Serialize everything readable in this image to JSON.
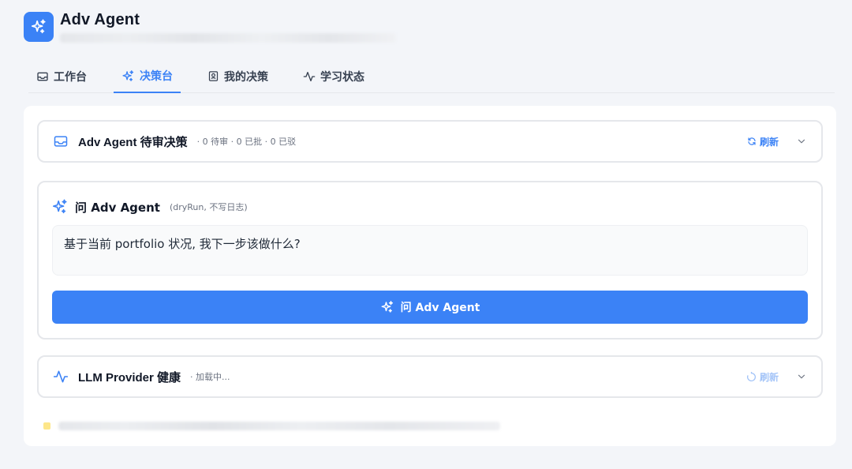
{
  "app": {
    "title": "Adv Agent"
  },
  "tabs": [
    {
      "label": "工作台",
      "icon": "inbox-icon"
    },
    {
      "label": "决策台",
      "icon": "sparkles-icon"
    },
    {
      "label": "我的决策",
      "icon": "user-square-icon"
    },
    {
      "label": "学习状态",
      "icon": "activity-icon"
    }
  ],
  "queue": {
    "title": "Adv Agent 待审决策",
    "meta": "· 0 待审 · 0 已批 · 0 已驳",
    "refresh": "刷新"
  },
  "ask": {
    "title": "问 Adv Agent",
    "hint": "(dryRun, 不写日志)",
    "input_value": "基于当前 portfolio 状况, 我下一步该做什么?",
    "button_label": "问 Adv Agent"
  },
  "llm": {
    "title": "LLM Provider 健康",
    "meta": "· 加载中...",
    "refresh": "刷新"
  },
  "colors": {
    "accent": "#3b82f6",
    "panel_bg": "#ffffff",
    "page_bg": "#f3f5f9"
  }
}
